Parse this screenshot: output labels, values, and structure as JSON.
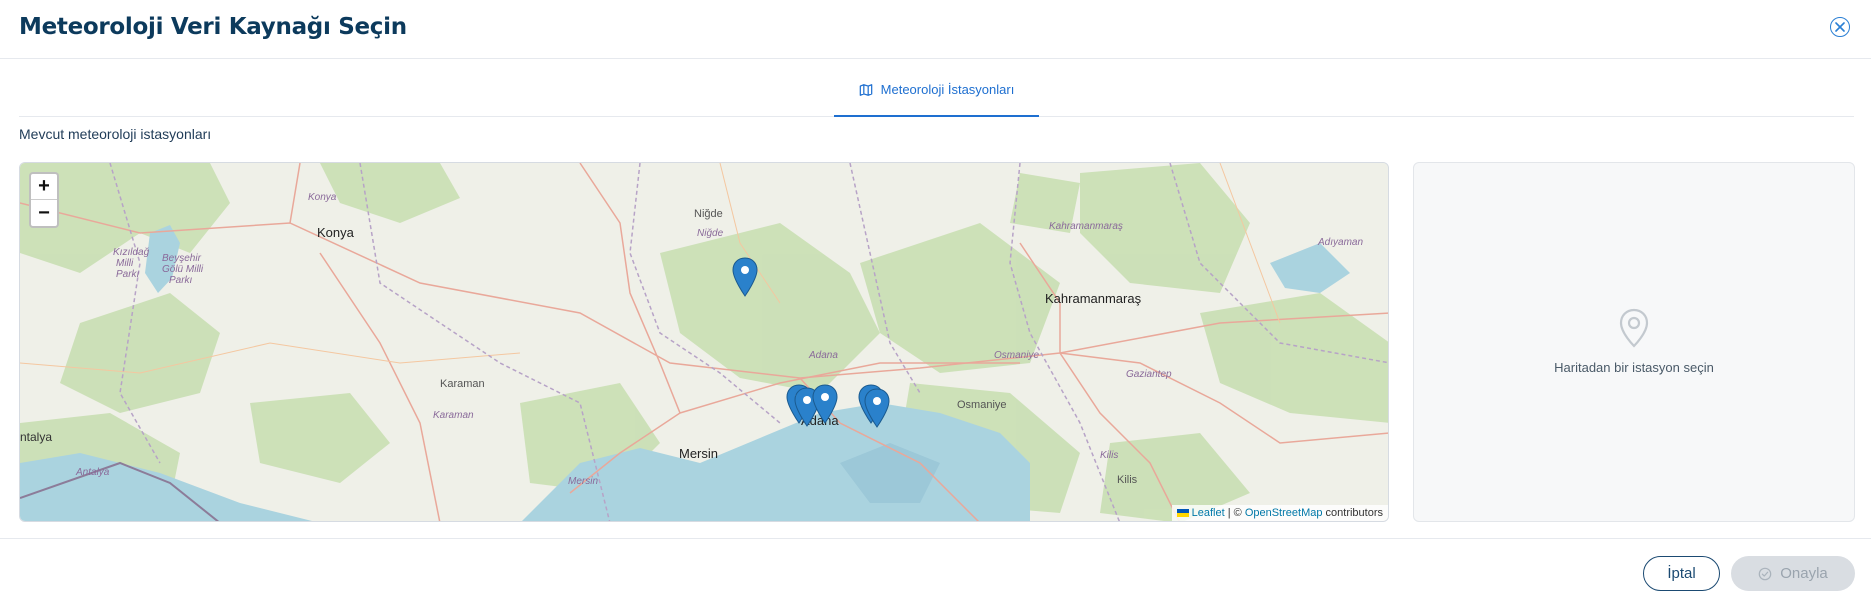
{
  "modal": {
    "title": "Meteoroloji Veri Kaynağı Seçin"
  },
  "tabs": [
    {
      "label": "Meteoroloji İstasyonları",
      "icon": "map-icon",
      "active": true
    }
  ],
  "subtitle": "Mevcut meteoroloji istasyonları",
  "map": {
    "zoom_in": "+",
    "zoom_out": "−",
    "labels": {
      "konya_region": "Konya",
      "konya": "Konya",
      "kizildag": "Kızıldağ",
      "milli": "Milli",
      "parki": "Parkı",
      "beysehir": "Beyşehir",
      "golu": "Gölü Milli",
      "parki2": "Parkı",
      "nigde": "Niğde",
      "nigde2": "Niğde",
      "karaman": "Karaman",
      "karaman2": "Karaman",
      "adana_region": "Adana",
      "adana": "Adana",
      "mersin": "Mersin",
      "mersin2": "Mersin",
      "osmaniye_region": "Osmaniye",
      "osmaniye": "Osmaniye",
      "kahramanmaras_region": "Kahramanmaraş",
      "kahramanmaras": "Kahramanmaraş",
      "adiyaman": "Adıyaman",
      "gaziantep": "Gaziantep",
      "kilis_region": "Kilis",
      "kilis": "Kilis",
      "antalya_city": "ntalya",
      "antalya": "Antalya"
    },
    "attribution": {
      "leaflet": "Leaflet",
      "separator": " | © ",
      "osm": "OpenStreetMap",
      "contributors": " contributors"
    }
  },
  "side_panel": {
    "icon": "location-pin-icon",
    "message": "Haritadan bir istasyon seçin"
  },
  "footer": {
    "cancel_label": "İptal",
    "confirm_label": "Onayla",
    "confirm_icon": "check-circle-icon"
  },
  "colors": {
    "primary": "#1e6fd0",
    "title": "#0c3a5c",
    "marker": "#2a81cb",
    "disabled_bg": "#d9dde2"
  }
}
